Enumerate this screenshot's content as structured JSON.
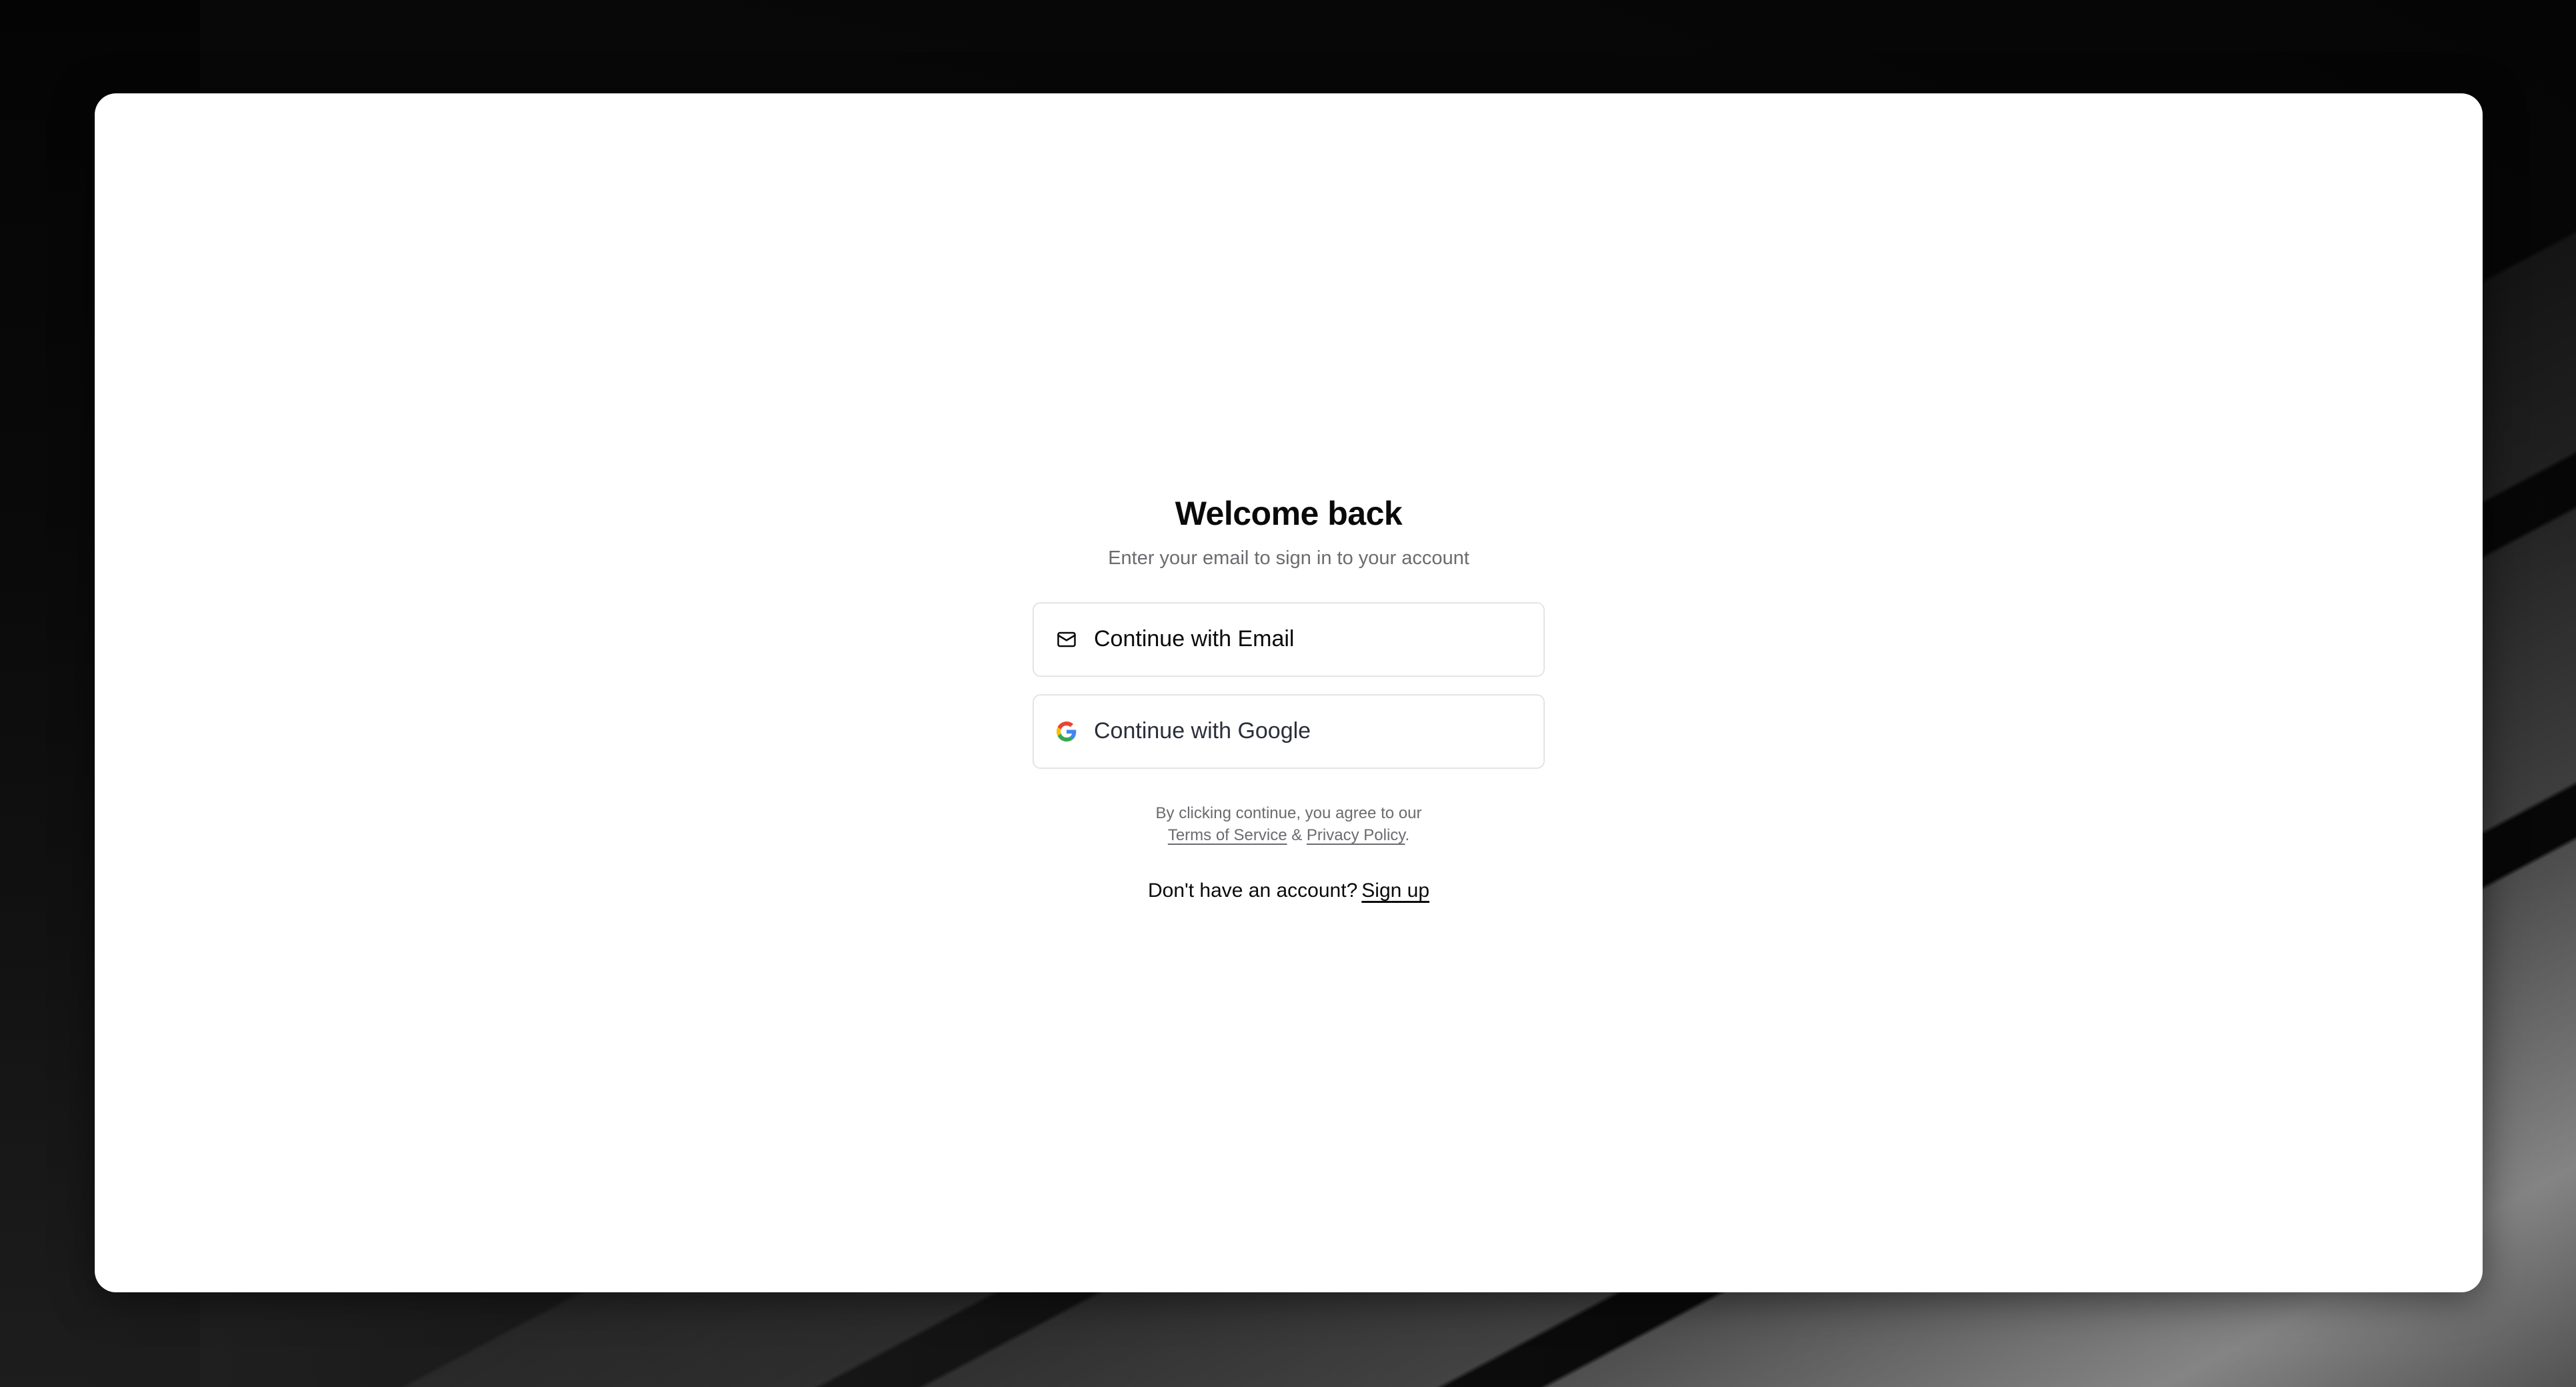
{
  "auth": {
    "title": "Welcome back",
    "subtitle": "Enter your email to sign in to your account",
    "email_button_label": "Continue with Email",
    "google_button_label": "Continue with Google",
    "terms_prefix": "By clicking continue, you agree to our",
    "terms_link": "Terms of Service",
    "terms_joiner": "&",
    "privacy_link": "Privacy Policy",
    "terms_suffix": ".",
    "signup_prompt": "Don't have an account?",
    "signup_link": "Sign up"
  },
  "icons": {
    "email": "mail-icon",
    "google": "google-icon"
  },
  "colors": {
    "text_primary": "#0a0a0a",
    "text_muted": "#6b6b70",
    "border": "#e4e4e7",
    "card_background": "#ffffff",
    "page_background": "#050505"
  }
}
